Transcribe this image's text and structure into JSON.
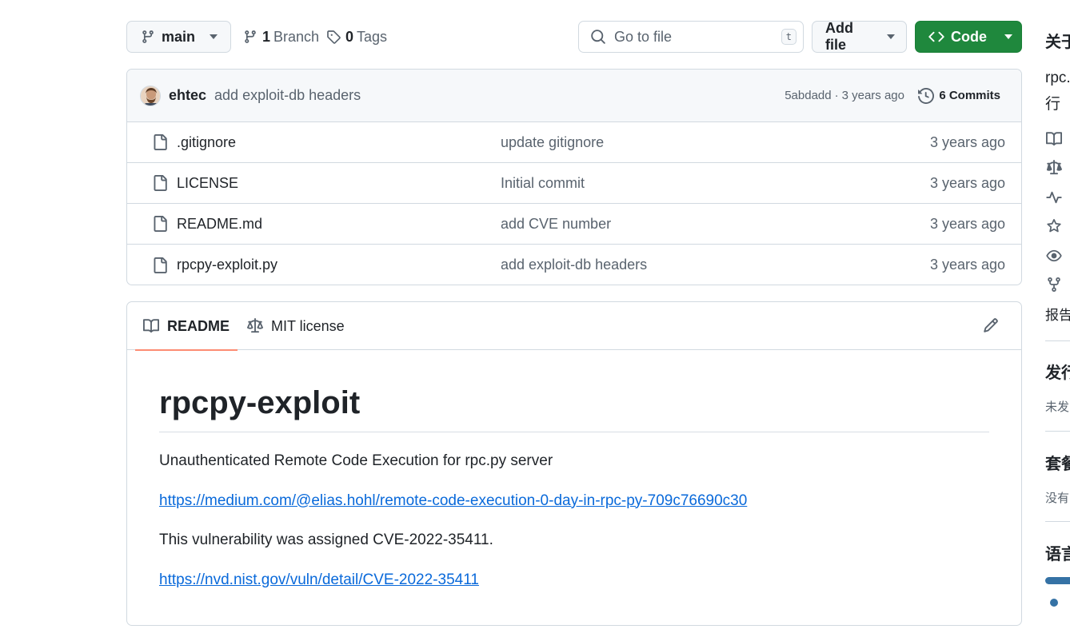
{
  "toolbar": {
    "branch": "main",
    "branches_count": "1",
    "branches_label": "Branch",
    "tags_count": "0",
    "tags_label": "Tags",
    "search_placeholder": "Go to file",
    "search_shortcut": "t",
    "add_file_label": "Add file",
    "code_label": "Code"
  },
  "latest_commit": {
    "author": "ehtec",
    "message": "add exploit-db headers",
    "sha": "5abdadd",
    "separator": "·",
    "age": "3 years ago",
    "commits_label": "6 Commits"
  },
  "files": [
    {
      "name": ".gitignore",
      "message": "update gitignore",
      "age": "3 years ago"
    },
    {
      "name": "LICENSE",
      "message": "Initial commit",
      "age": "3 years ago"
    },
    {
      "name": "README.md",
      "message": "add CVE number",
      "age": "3 years ago"
    },
    {
      "name": "rpcpy-exploit.py",
      "message": "add exploit-db headers",
      "age": "3 years ago"
    }
  ],
  "readme": {
    "tab_readme": "README",
    "tab_license": "MIT license",
    "title": "rpcpy-exploit",
    "description": "Unauthenticated Remote Code Execution for rpc.py server",
    "link1": "https://medium.com/@elias.hohl/remote-code-execution-0-day-in-rpc-py-709c76690c30",
    "cve_text": "This vulnerability was assigned CVE-2022-35411.",
    "link2": "https://nvd.nist.gov/vuln/detail/CVE-2022-35411"
  },
  "sidebar": {
    "about_heading": "关于",
    "about_text_line1": "rpc.",
    "about_text_line2": "行",
    "report_text": "报告",
    "releases_heading": "发行",
    "releases_text": "未发",
    "packages_heading": "套餐",
    "packages_text": "没有",
    "languages_heading": "语言",
    "language_color": "#3572A5"
  },
  "colors": {
    "code_button": "#1f883d",
    "link": "#0969da",
    "active_tab_underline": "#fd8c73"
  }
}
